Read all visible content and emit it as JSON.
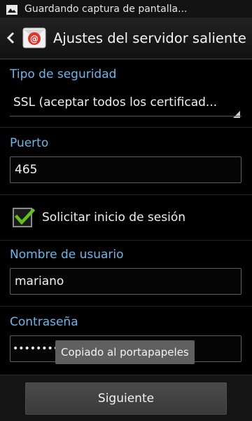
{
  "status_bar": {
    "icon": "image-icon",
    "text": "Guardando captura de pantalla..."
  },
  "action_bar": {
    "back_icon": "chevron-left-icon",
    "app_icon": "email-at-icon",
    "title": "Ajustes del servidor saliente"
  },
  "security": {
    "label": "Tipo de seguridad",
    "selected": "SSL (aceptar todos los certificad..."
  },
  "port": {
    "label": "Puerto",
    "value": "465"
  },
  "login": {
    "label": "Solicitar inicio de sesión",
    "checked": true
  },
  "username": {
    "label": "Nombre de usuario",
    "value": "mariano"
  },
  "password": {
    "label": "Contraseña",
    "value": "••••••••"
  },
  "toast": {
    "text": "Copiado al portapapeles"
  },
  "footer": {
    "next_label": "Siguiente"
  },
  "colors": {
    "accent": "#6fb5e8",
    "check": "#63c21a",
    "background": "#000000"
  }
}
